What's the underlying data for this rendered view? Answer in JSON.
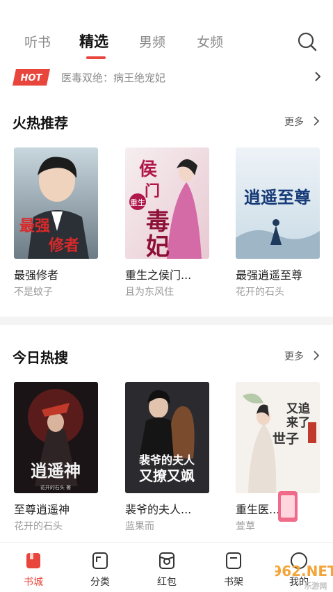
{
  "tabs": [
    {
      "label": "听书"
    },
    {
      "label": "精选"
    },
    {
      "label": "男频"
    },
    {
      "label": "女频"
    }
  ],
  "active_tab": "精选",
  "hot": {
    "badge": "HOT",
    "text": "医毒双绝：病王绝宠妃"
  },
  "sections": [
    {
      "title": "火热推荐",
      "more": "更多",
      "books": [
        {
          "title": "最强修者",
          "author": "不是蚊子",
          "cover_text": "最强修者"
        },
        {
          "title": "重生之侯门...",
          "author": "且为东风住",
          "cover_text": "重生之侯门毒妃"
        },
        {
          "title": "最强逍遥至尊",
          "author": "花开的石头",
          "cover_text": "逍遥至尊"
        }
      ]
    },
    {
      "title": "今日热搜",
      "more": "更多",
      "books": [
        {
          "title": "至尊逍遥神",
          "author": "花开的石头",
          "cover_text": "至尊逍遥神"
        },
        {
          "title": "裴爷的夫人...",
          "author": "蓝果而",
          "cover_text": "裴爷的夫人又撩又飒"
        },
        {
          "title": "重生医...",
          "author": "萱草",
          "cover_text": "又追来了世子"
        }
      ]
    }
  ],
  "bottom_nav": [
    {
      "label": "书城",
      "icon": "book-city-icon"
    },
    {
      "label": "分类",
      "icon": "category-icon"
    },
    {
      "label": "红包",
      "icon": "red-packet-icon"
    },
    {
      "label": "书架",
      "icon": "bookshelf-icon"
    },
    {
      "label": "我的",
      "icon": "profile-icon"
    }
  ],
  "watermark": {
    "text": "962.NET",
    "subtext": "乐游网"
  },
  "colors": {
    "accent": "#e8453c",
    "muted": "#8a8a8a"
  }
}
